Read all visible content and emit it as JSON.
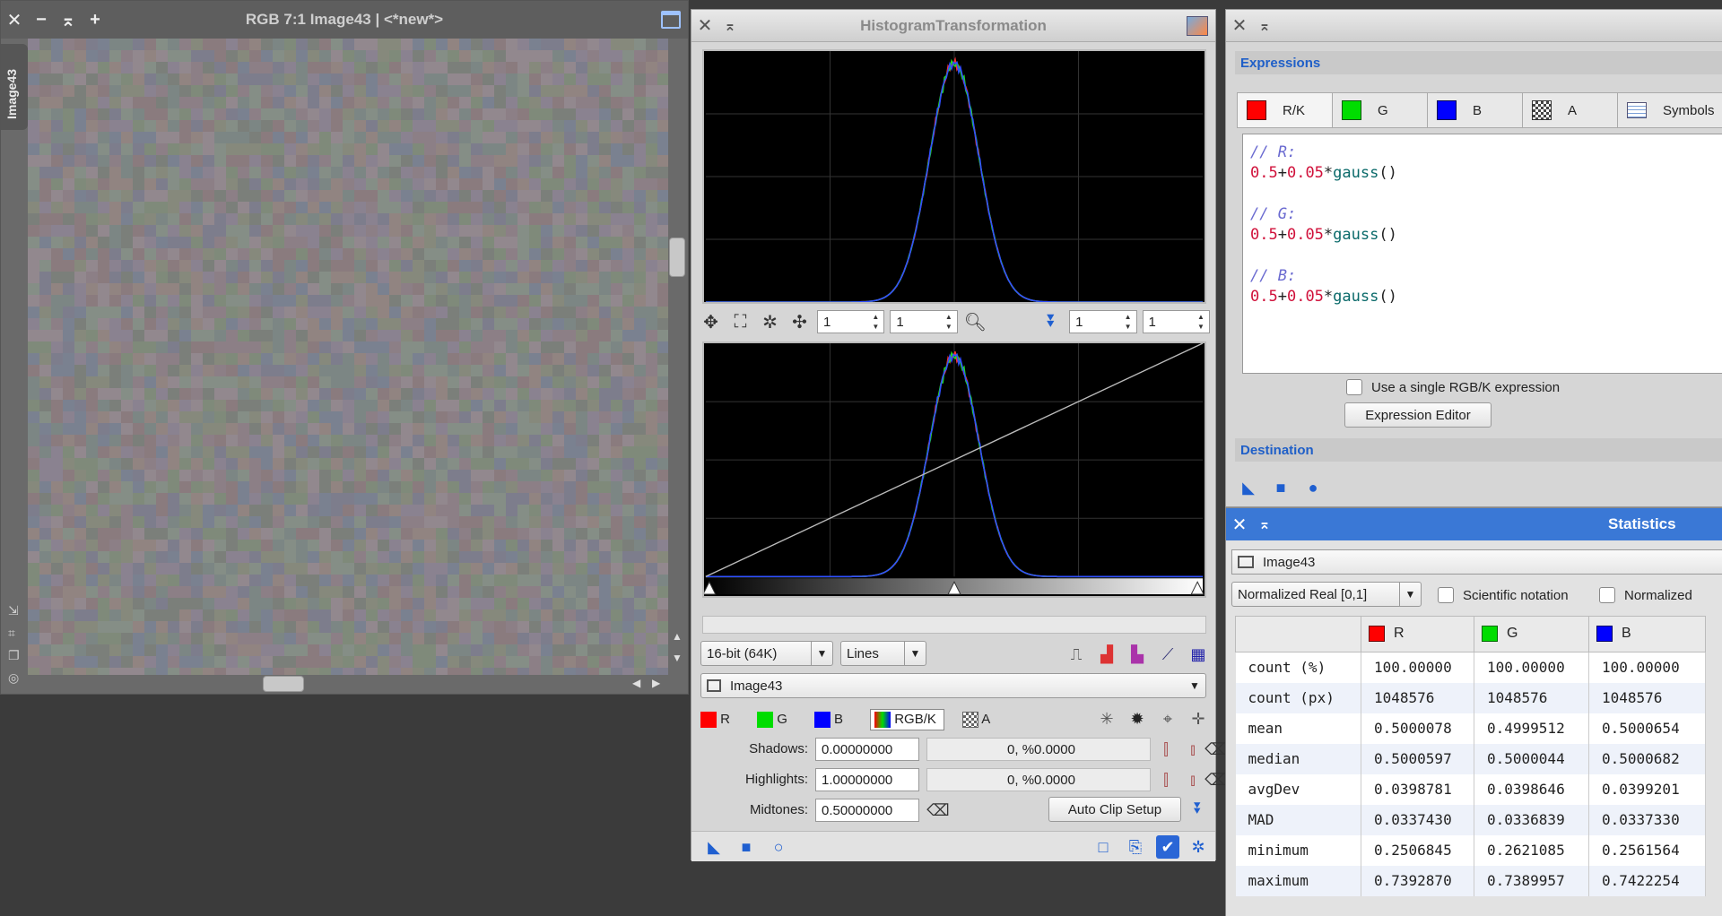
{
  "image_window": {
    "title": "RGB 7:1 Image43 | <*new*>",
    "close": "✕",
    "minimize": "−",
    "shade": "⌅",
    "add": "+",
    "vertical_tab": "Image43",
    "noise_colors": [
      "#8a8290",
      "#7f8a7a",
      "#8c7f86",
      "#7a8190",
      "#86897c",
      "#918481",
      "#7d7d8c",
      "#858e86",
      "#8a7b7e",
      "#7c8684",
      "#92888e",
      "#7b7f7a"
    ]
  },
  "histogram": {
    "title": "HistogramTransformation",
    "close": "✕",
    "pin": "⌅",
    "zoom_h1": "1",
    "zoom_v1": "1",
    "zoom_h2": "1",
    "zoom_v2": "1",
    "resolution": "16-bit (64K)",
    "graph_style": "Lines",
    "view": "Image43",
    "channels": {
      "r": "R",
      "g": "G",
      "b": "B",
      "rgbk": "RGB/K",
      "a": "A"
    },
    "shadows_label": "Shadows:",
    "shadows_value": "0.00000000",
    "shadows_clip": "0, %0.0000",
    "highlights_label": "Highlights:",
    "highlights_value": "1.00000000",
    "highlights_clip": "0, %0.0000",
    "midtones_label": "Midtones:",
    "midtones_value": "0.50000000",
    "auto_clip": "Auto Clip Setup",
    "colors": {
      "r": "#ff0000",
      "g": "#00dd00",
      "b": "#0000ff"
    }
  },
  "pixelmath": {
    "close": "✕",
    "pin": "⌅",
    "expressions_header": "Expressions",
    "tabs": [
      {
        "label": "R/K",
        "color": "#ff0000"
      },
      {
        "label": "G",
        "color": "#00dd00"
      },
      {
        "label": "B",
        "color": "#0000ff"
      },
      {
        "label": "A",
        "color": "pattern"
      },
      {
        "label": "Symbols",
        "color": "table"
      }
    ],
    "code": {
      "c1": "// R:",
      "n1a": "0.5",
      "op1": "+",
      "n1b": "0.05",
      "m1": "*",
      "f1": "gauss",
      "p1": "()",
      "c2": "// G:",
      "n2a": "0.5",
      "op2": "+",
      "n2b": "0.05",
      "m2": "*",
      "f2": "gauss",
      "p2": "()",
      "c3": "// B:",
      "n3a": "0.5",
      "op3": "+",
      "n3b": "0.05",
      "m3": "*",
      "f3": "gauss",
      "p3": "()"
    },
    "single_expr_label": "Use a single RGB/K expression",
    "expression_editor": "Expression Editor",
    "destination_header": "Destination"
  },
  "statistics": {
    "title": "Statistics",
    "close": "✕",
    "pin": "⌅",
    "view": "Image43",
    "range": "Normalized Real [0,1]",
    "scientific": "Scientific notation",
    "normalized": "Normalized",
    "columns": [
      {
        "label": "R",
        "color": "#ff0000"
      },
      {
        "label": "G",
        "color": "#00dd00"
      },
      {
        "label": "B",
        "color": "#0000ff"
      }
    ],
    "rows": [
      {
        "name": "count (%)",
        "values": [
          "100.00000",
          "100.00000",
          "100.00000"
        ]
      },
      {
        "name": "count (px)",
        "values": [
          "1048576",
          "1048576",
          "1048576"
        ]
      },
      {
        "name": "mean",
        "values": [
          "0.5000078",
          "0.4999512",
          "0.5000654"
        ]
      },
      {
        "name": "median",
        "values": [
          "0.5000597",
          "0.5000044",
          "0.5000682"
        ]
      },
      {
        "name": "avgDev",
        "values": [
          "0.0398781",
          "0.0398646",
          "0.0399201"
        ]
      },
      {
        "name": "MAD",
        "values": [
          "0.0337430",
          "0.0336839",
          "0.0337330"
        ]
      },
      {
        "name": "minimum",
        "values": [
          "0.2506845",
          "0.2621085",
          "0.2561564"
        ]
      },
      {
        "name": "maximum",
        "values": [
          "0.7392870",
          "0.7389957",
          "0.7422254"
        ]
      }
    ]
  }
}
